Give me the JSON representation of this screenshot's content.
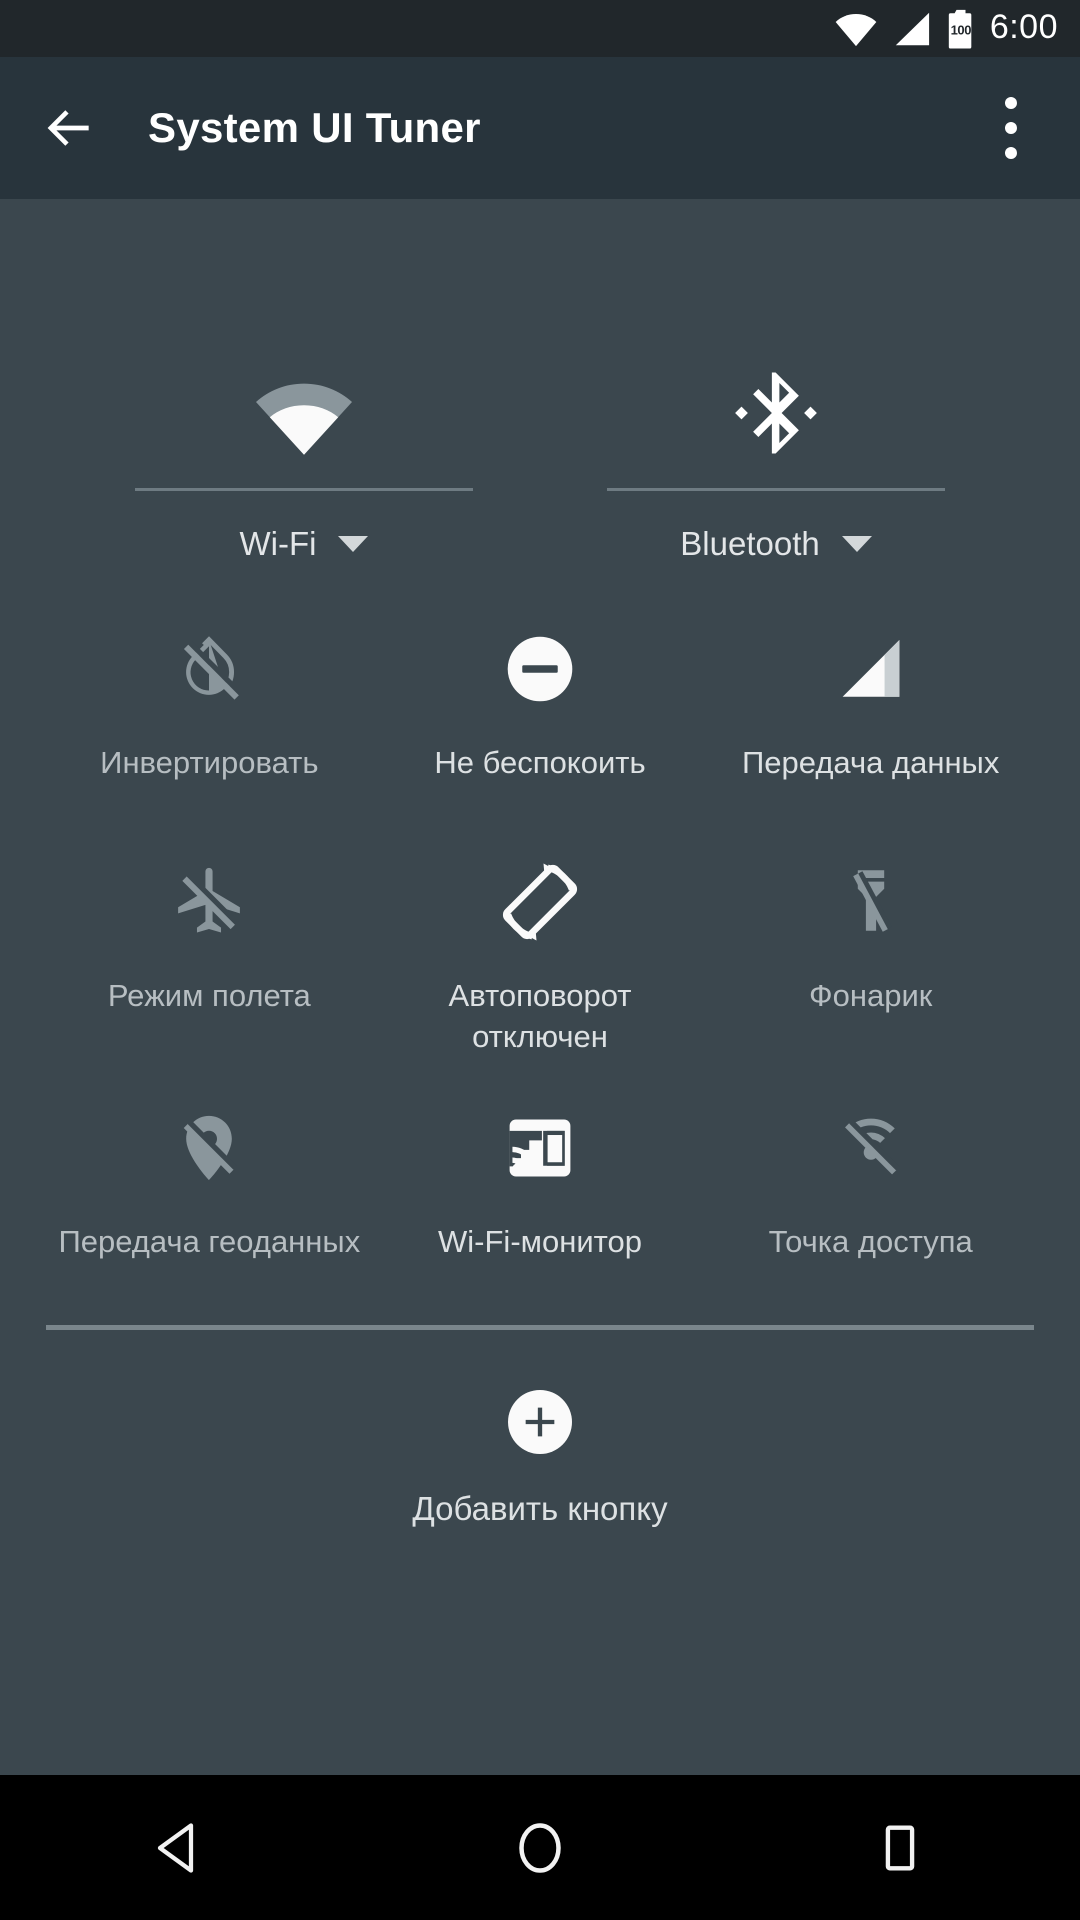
{
  "status_bar": {
    "wifi_icon": "wifi-icon",
    "signal_icon": "cell-signal-icon",
    "battery_icon": "battery-icon",
    "battery_level": "100",
    "time": "6:00"
  },
  "app_bar": {
    "back_icon": "arrow-back-icon",
    "title": "System UI Tuner",
    "overflow_icon": "more-vert-icon"
  },
  "quick_settings": {
    "dual_tiles": [
      {
        "label": "Wi-Fi",
        "icon": "wifi-icon",
        "state": "on",
        "expandable": true
      },
      {
        "label": "Bluetooth",
        "icon": "bluetooth-icon",
        "state": "on",
        "expandable": true
      }
    ],
    "tiles": [
      {
        "label": "Инвертировать",
        "icon": "invert-colors-off-icon",
        "state": "off"
      },
      {
        "label": "Не беспокоить",
        "icon": "do-not-disturb-icon",
        "state": "on"
      },
      {
        "label": "Передача данных",
        "icon": "cell-signal-icon",
        "state": "on"
      },
      {
        "label": "Режим полета",
        "icon": "airplane-off-icon",
        "state": "off"
      },
      {
        "label": "Автоповорот\nотключен",
        "icon": "screen-rotation-icon",
        "state": "on"
      },
      {
        "label": "Фонарик",
        "icon": "flashlight-off-icon",
        "state": "off"
      },
      {
        "label": "Передача геоданных",
        "icon": "location-off-icon",
        "state": "off"
      },
      {
        "label": "Wi-Fi-монитор",
        "icon": "cast-icon",
        "state": "on"
      },
      {
        "label": "Точка доступа",
        "icon": "hotspot-off-icon",
        "state": "off"
      }
    ],
    "add_button": {
      "icon": "add-circle-icon",
      "label": "Добавить кнопку"
    }
  },
  "nav_bar": {
    "back_icon": "nav-back-icon",
    "home_icon": "nav-home-icon",
    "recents_icon": "nav-recents-icon"
  },
  "colors": {
    "panel_background": "#3B474E",
    "app_bar_background": "#28343C",
    "status_bar_background": "#21272B",
    "nav_bar_background": "#000000",
    "icon_active": "#FFFFFF",
    "icon_inactive": "#8A969C",
    "label_text": "#DDE1E3",
    "divider": "#6E7B82"
  }
}
